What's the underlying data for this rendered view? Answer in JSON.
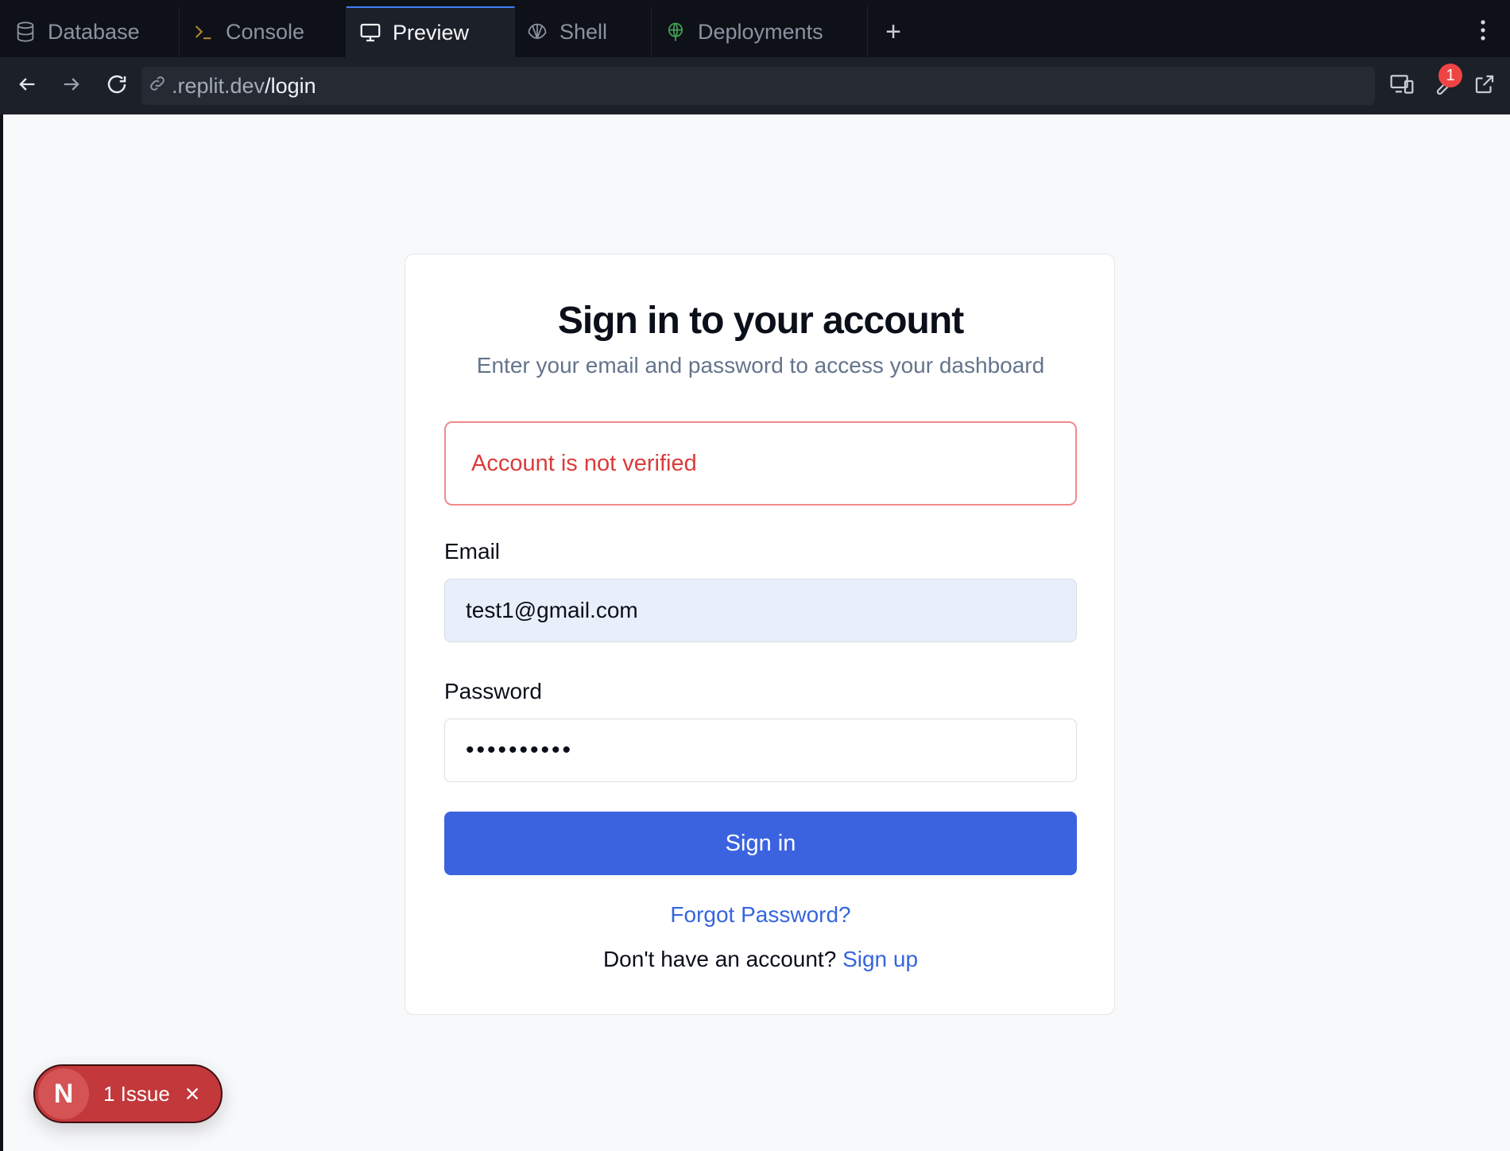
{
  "tabs": [
    {
      "label": "Database",
      "icon": "database-icon",
      "active": false
    },
    {
      "label": "Console",
      "icon": "terminal-icon",
      "active": false
    },
    {
      "label": "Preview",
      "icon": "monitor-icon",
      "active": true
    },
    {
      "label": "Shell",
      "icon": "shell-icon",
      "active": false
    },
    {
      "label": "Deployments",
      "icon": "globe-icon",
      "active": false
    }
  ],
  "add_tab_label": "+",
  "url": {
    "domain": ".replit.dev",
    "path": "/login"
  },
  "notification_count": "1",
  "card": {
    "title": "Sign in to your account",
    "subtitle": "Enter your email and password to access your dashboard",
    "error": "Account is not verified",
    "email_label": "Email",
    "email_value": "test1@gmail.com",
    "password_label": "Password",
    "password_value": "••••••••••",
    "submit_label": "Sign in",
    "forgot_label": "Forgot Password?",
    "signup_prompt": "Don't have an account?",
    "signup_link": "Sign up"
  },
  "issue": {
    "logo_letter": "N",
    "label": "1 Issue"
  },
  "colors": {
    "primary": "#3b63e0",
    "error": "#dc3b3b",
    "issue": "#c2383b",
    "link": "#3565dd"
  }
}
